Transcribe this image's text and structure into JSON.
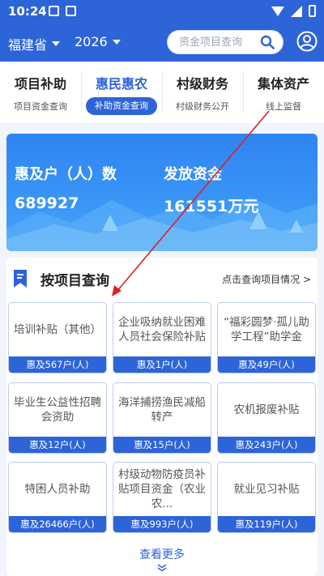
{
  "status": {
    "time": "10:24"
  },
  "header": {
    "province": "福建省",
    "year": "2026",
    "search_placeholder": "资金项目查询"
  },
  "tabs": [
    {
      "title": "项目补助",
      "sub": "项目资金查询",
      "active": false
    },
    {
      "title": "惠民惠农",
      "sub": "补助资金查询",
      "active": true
    },
    {
      "title": "村级财务",
      "sub": "村级财务公开",
      "active": false
    },
    {
      "title": "集体资产",
      "sub": "线上监督",
      "active": false
    }
  ],
  "banner": {
    "households_label": "惠及户（人）数",
    "households_value": "689927",
    "funds_label": "发放资金",
    "funds_value": "161551万元"
  },
  "section": {
    "title": "按项目查询",
    "link": "点击查询项目情况 >",
    "more": "查看更多"
  },
  "cards": [
    {
      "name": "培训补贴（其他）",
      "count": "惠及567户(人)"
    },
    {
      "name": "企业吸纳就业困难人员社会保险补贴",
      "count": "惠及1户(人)"
    },
    {
      "name": "“福彩圆梦·孤儿助学工程”助学金",
      "count": "惠及49户(人)"
    },
    {
      "name": "毕业生公益性招聘会资助",
      "count": "惠及12户(人)"
    },
    {
      "name": "海洋捕捞渔民减船转产",
      "count": "惠及15户(人)"
    },
    {
      "name": "农机报废补贴",
      "count": "惠及243户(人)"
    },
    {
      "name": "特困人员补助",
      "count": "惠及26466户(人)"
    },
    {
      "name": "村级动物防疫员补贴项目资金（农业农...",
      "count": "惠及993户(人)"
    },
    {
      "name": "就业见习补贴",
      "count": "惠及119户(人)"
    }
  ],
  "colors": {
    "primary": "#2d64d8",
    "banner": "#3a96f6",
    "annotation_arrow": "#e02020"
  }
}
